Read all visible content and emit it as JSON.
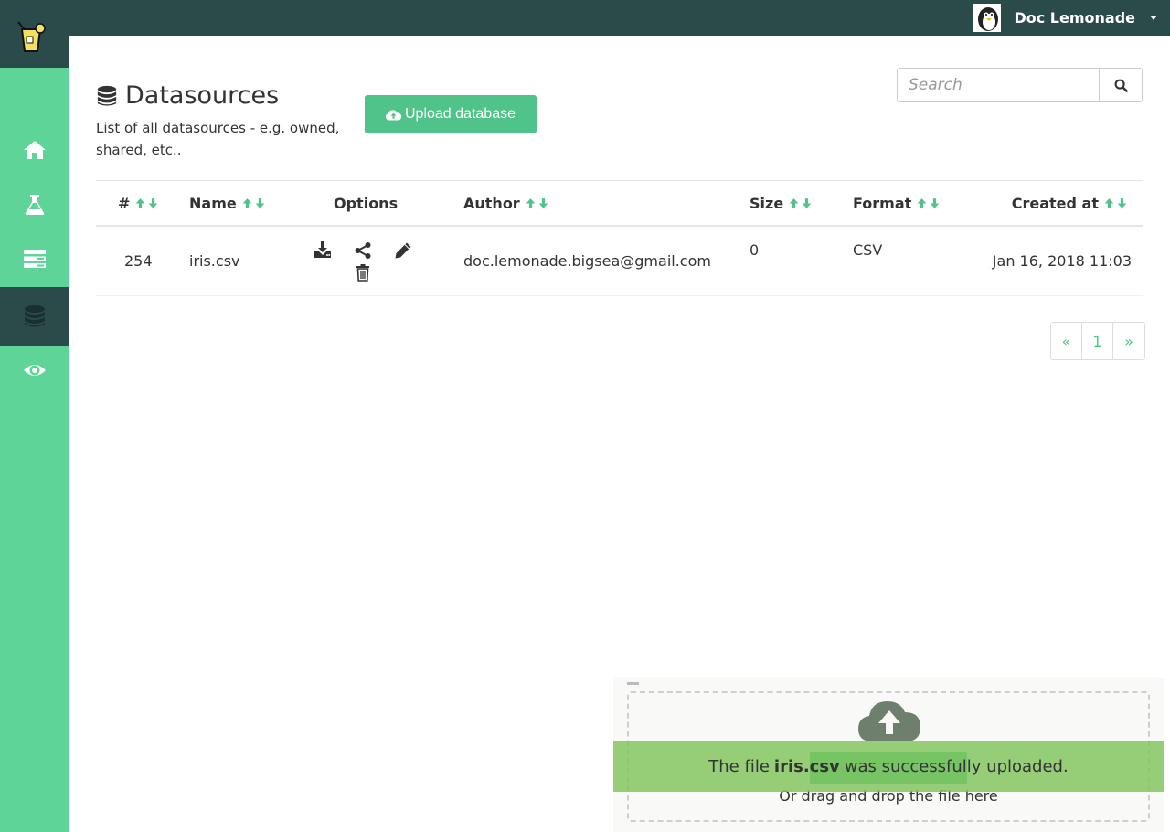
{
  "header": {
    "user_name": "Doc Lemonade"
  },
  "sidebar": {
    "items": [
      {
        "name": "home-icon",
        "active": false
      },
      {
        "name": "flask-icon",
        "active": false
      },
      {
        "name": "tasks-icon",
        "active": false
      },
      {
        "name": "database-icon",
        "active": true
      },
      {
        "name": "eye-icon",
        "active": false
      }
    ]
  },
  "page": {
    "title": "Datasources",
    "description": "List of all datasources - e.g. owned, shared, etc..",
    "upload_label": "Upload database"
  },
  "search": {
    "placeholder": "Search"
  },
  "table": {
    "headers": {
      "id": "#",
      "name": "Name",
      "options": "Options",
      "author": "Author",
      "size": "Size",
      "format": "Format",
      "created": "Created at"
    },
    "rows": [
      {
        "id": "254",
        "name": "iris.csv",
        "author": "doc.lemonade.bigsea@gmail.com",
        "size": "0",
        "format": "CSV",
        "created": "Jan 16, 2018 11:03"
      }
    ]
  },
  "pagination": {
    "prev": "«",
    "page": "1",
    "next": "»"
  },
  "dropzone": {
    "or_text": "Or drag and drop the file here"
  },
  "toast": {
    "prefix": "The file",
    "filename": "iris.csv",
    "suffix": "was successfully uploaded."
  },
  "colors": {
    "topbar": "#2b4a4a",
    "sidebar": "#5fd498",
    "accent": "#4fc389",
    "toast": "#80c45c"
  }
}
